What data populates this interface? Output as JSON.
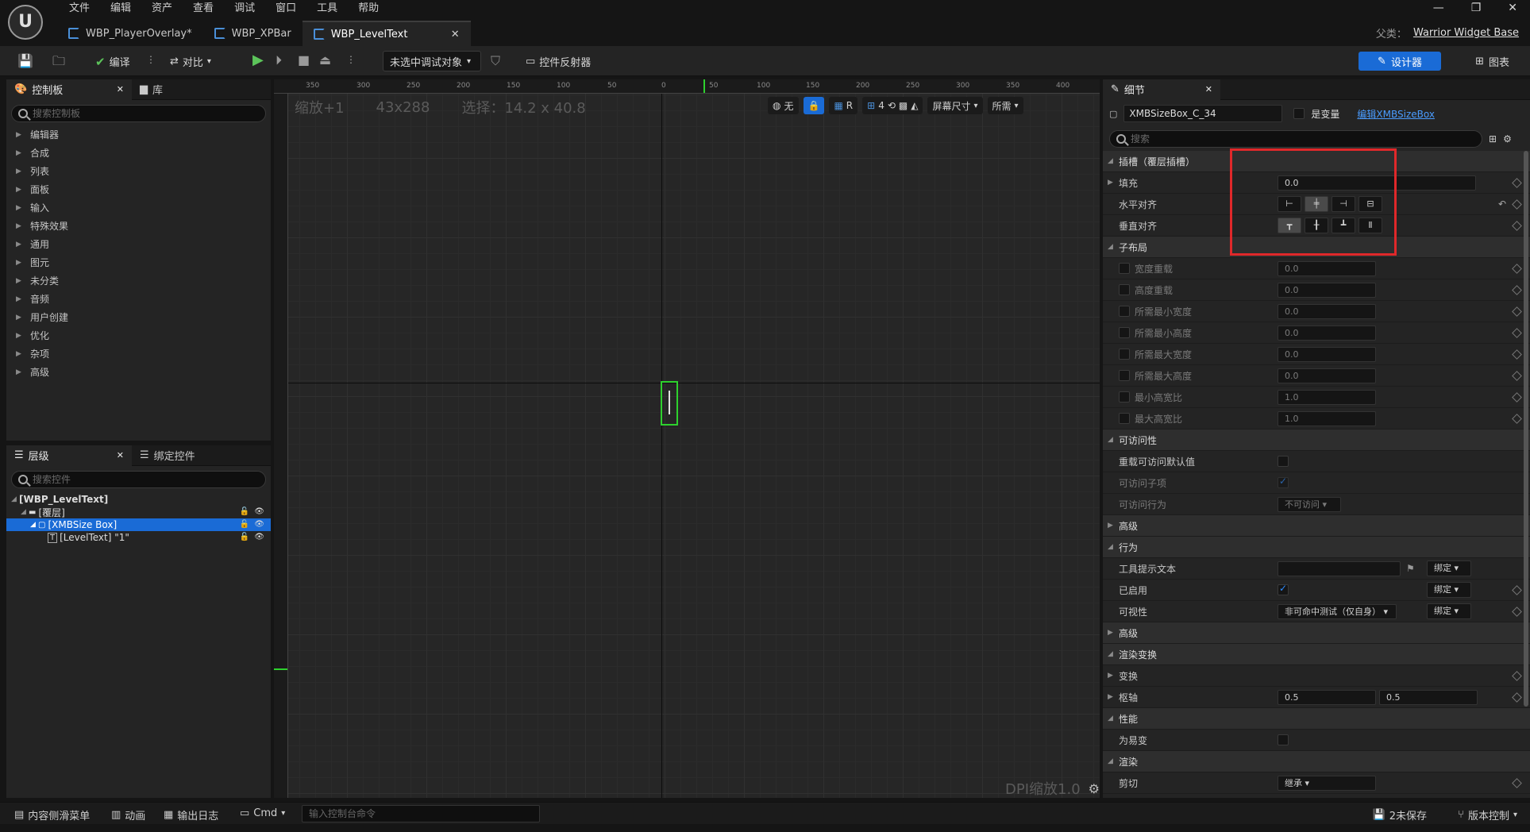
{
  "menu": [
    "文件",
    "编辑",
    "资产",
    "查看",
    "调试",
    "窗口",
    "工具",
    "帮助"
  ],
  "tabs": [
    {
      "label": "WBP_PlayerOverlay*"
    },
    {
      "label": "WBP_XPBar"
    },
    {
      "label": "WBP_LevelText"
    }
  ],
  "parent_class": {
    "label": "父类：",
    "value": "Warrior Widget Base"
  },
  "toolbar": {
    "compile": "编译",
    "diff": "对比",
    "debug_target": "未选中调试对象",
    "widget_reflector": "控件反射器",
    "designer": "设计器",
    "graph": "图表"
  },
  "palette": {
    "tab": "控制板",
    "library_tab": "库",
    "search_placeholder": "搜索控制板",
    "categories": [
      "编辑器",
      "合成",
      "列表",
      "面板",
      "输入",
      "特殊效果",
      "通用",
      "图元",
      "未分类",
      "音频",
      "用户创建",
      "优化",
      "杂项",
      "高级"
    ]
  },
  "hierarchy": {
    "tab": "层级",
    "bind_tab": "绑定控件",
    "search_placeholder": "搜索控件",
    "items": [
      "[WBP_LevelText]",
      "[覆层]",
      "[XMBSize Box]",
      "[LevelText] \"1\""
    ]
  },
  "canvas": {
    "zoom": "缩放+1",
    "size": "43x288",
    "selection": "选择：14.2 x 40.8",
    "ctl_none": "无",
    "ctl_r": "R",
    "ctl_grid": "4",
    "screen_size": "屏幕尺寸",
    "fill_mode": "所需",
    "dpi": "DPI缩放1.0",
    "ruler_top": [
      "350",
      "300",
      "250",
      "200",
      "150",
      "100",
      "50",
      "0",
      "50",
      "100",
      "150",
      "200",
      "250",
      "300",
      "350",
      "400"
    ]
  },
  "details": {
    "tab": "细节",
    "name_value": "XMBSizeBox_C_34",
    "is_variable": "是变量",
    "edit_link": "编辑XMBSizeBox",
    "search_placeholder": "搜索",
    "slot_cat": "插槽（覆层插槽）",
    "padding_label": "填充",
    "padding_value": "0.0",
    "h_align": "水平对齐",
    "v_align": "垂直对齐",
    "child_layout": "子布局",
    "child_rows": [
      {
        "label": "宽度重载",
        "value": "0.0"
      },
      {
        "label": "高度重载",
        "value": "0.0"
      },
      {
        "label": "所需最小宽度",
        "value": "0.0"
      },
      {
        "label": "所需最小高度",
        "value": "0.0"
      },
      {
        "label": "所需最大宽度",
        "value": "0.0"
      },
      {
        "label": "所需最大高度",
        "value": "0.0"
      },
      {
        "label": "最小高宽比",
        "value": "1.0"
      },
      {
        "label": "最大高宽比",
        "value": "1.0"
      }
    ],
    "accessibility": "可访问性",
    "override_access": "重载可访问默认值",
    "access_children": "可访问子项",
    "access_behavior": "可访问行为",
    "access_behavior_value": "不可访问",
    "advanced1": "高级",
    "behavior": "行为",
    "tooltip_text": "工具提示文本",
    "bind": "绑定",
    "enabled": "已启用",
    "visibility": "可视性",
    "visibility_value": "非可命中测试（仅自身）",
    "advanced2": "高级",
    "render_transform": "渲染变换",
    "transform": "变换",
    "pivot": "枢轴",
    "pivot_x": "0.5",
    "pivot_y": "0.5",
    "performance": "性能",
    "volatile": "为易变",
    "rendering": "渲染",
    "clipping": "剪切",
    "clipping_value": "继承"
  },
  "bottombar": {
    "content_drawer": "内容侧滑菜单",
    "animation": "动画",
    "output_log": "输出日志",
    "cmd": "Cmd",
    "console_placeholder": "输入控制台命令",
    "unsaved": "2未保存",
    "source_control": "版本控制"
  }
}
